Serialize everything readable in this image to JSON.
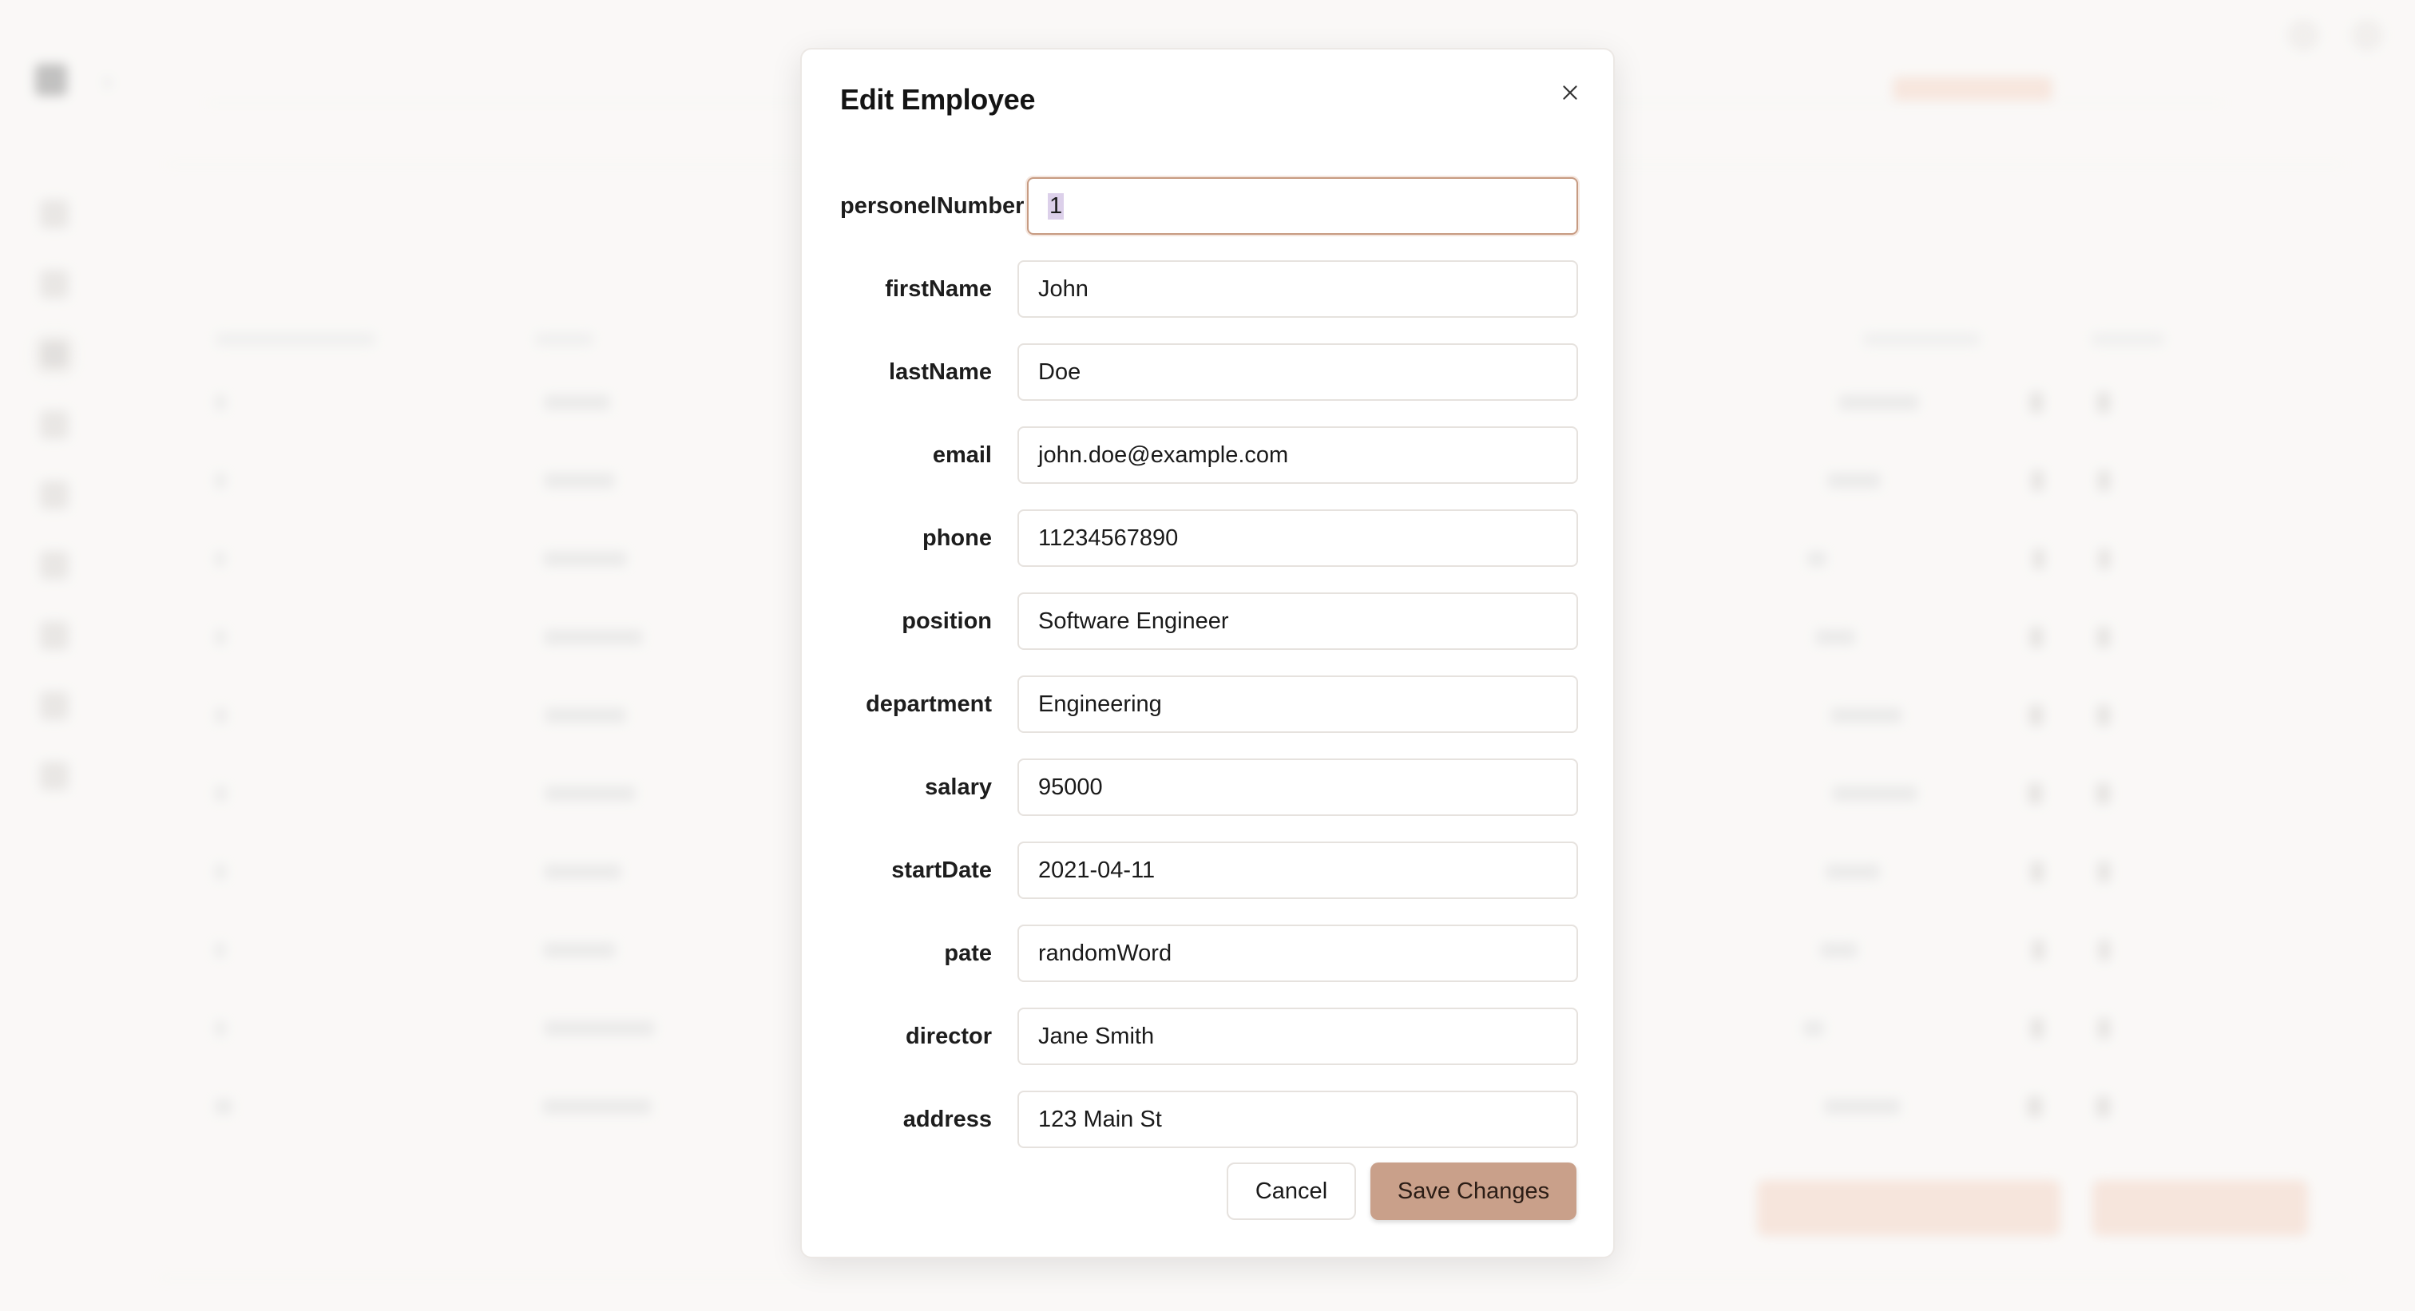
{
  "modal": {
    "title": "Edit Employee",
    "fields": [
      {
        "label": "personelNumber",
        "value": "1"
      },
      {
        "label": "firstName",
        "value": "John"
      },
      {
        "label": "lastName",
        "value": "Doe"
      },
      {
        "label": "email",
        "value": "john.doe@example.com"
      },
      {
        "label": "phone",
        "value": "11234567890"
      },
      {
        "label": "position",
        "value": "Software Engineer"
      },
      {
        "label": "department",
        "value": "Engineering"
      },
      {
        "label": "salary",
        "value": "95000"
      },
      {
        "label": "startDate",
        "value": "2021-04-11"
      },
      {
        "label": "pate",
        "value": "randomWord"
      },
      {
        "label": "director",
        "value": "Jane Smith"
      },
      {
        "label": "address",
        "value": "123 Main St"
      }
    ],
    "cancel_label": "Cancel",
    "save_label": "Save Changes"
  },
  "colors": {
    "accent": "#c9a08a",
    "focus_border": "#c79b82",
    "background": "#f7f5f3"
  },
  "icons": {
    "close": "close-icon"
  }
}
